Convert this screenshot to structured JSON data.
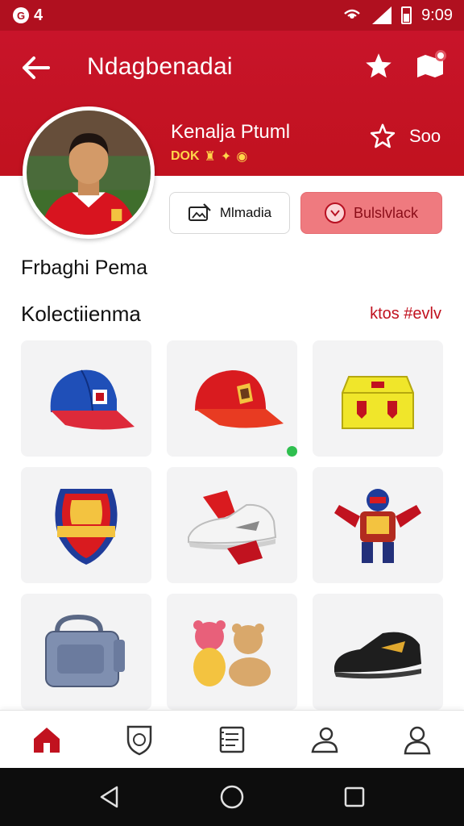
{
  "status_bar": {
    "notification": "4",
    "time": "9:09"
  },
  "header": {
    "title": "Ndagbenadai"
  },
  "profile": {
    "name": "Kenalja Ptuml",
    "subtitle": "DOK",
    "star_count": "Soo"
  },
  "buttons": {
    "outline_label": "Mlmadia",
    "red_label": "Bulslvlack"
  },
  "section": {
    "title": "Frbaghi Pema"
  },
  "collection": {
    "title": "Kolectiienma",
    "see_all": "ktos #evlv",
    "items": [
      {
        "icon": "blue-cap-icon"
      },
      {
        "icon": "red-cap-icon"
      },
      {
        "icon": "yellow-box-icon"
      },
      {
        "icon": "team-crest-icon"
      },
      {
        "icon": "sneaker-icon"
      },
      {
        "icon": "robot-figure-icon"
      },
      {
        "icon": "backpack-icon"
      },
      {
        "icon": "teddy-bears-icon"
      },
      {
        "icon": "football-boot-icon"
      }
    ]
  },
  "nav": {
    "items": [
      "home-icon",
      "shield-icon",
      "list-icon",
      "person-icon",
      "profile-icon"
    ],
    "active": "home-icon"
  },
  "colors": {
    "brand": "#c1121f",
    "accent_button": "#ef7a7f",
    "online": "#2fbf4f"
  }
}
